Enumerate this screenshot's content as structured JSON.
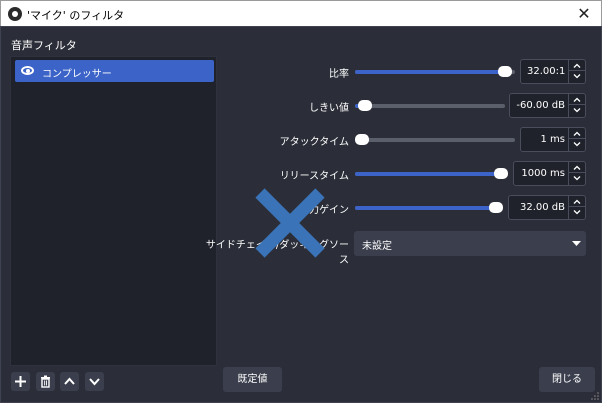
{
  "window": {
    "title": "'マイク' のフィルタ",
    "close_glyph": "✕",
    "close_icon": "close-icon"
  },
  "filters_panel": {
    "label": "音声フィルタ",
    "items": [
      {
        "name": "コンプレッサー",
        "visible": true,
        "selected": true
      }
    ],
    "toolbar": [
      "add-icon",
      "trash-icon",
      "chevron-up-icon",
      "chevron-down-icon"
    ]
  },
  "properties": {
    "ratio": {
      "label": "比率",
      "value": "32.00:1",
      "slider_fraction": 0.98
    },
    "threshold": {
      "label": "しきい値",
      "value": "-60.00 dB",
      "slider_fraction": 0.02
    },
    "attack": {
      "label": "アタックタイム",
      "value": "1 ms",
      "slider_fraction": 0.0
    },
    "release": {
      "label": "リリースタイム",
      "value": "1000 ms",
      "slider_fraction": 1.0
    },
    "output_gain": {
      "label": "出力ゲイン",
      "value": "32.00 dB",
      "slider_fraction": 1.0
    },
    "sidechain": {
      "label": "サイドチェイン/ダッキングソース",
      "value": "未設定"
    }
  },
  "buttons": {
    "defaults": "既定値",
    "close": "閉じる"
  },
  "colors": {
    "accent": "#3c64c8",
    "background": "#2b2e38",
    "overlay_x": "#3a73b8"
  }
}
